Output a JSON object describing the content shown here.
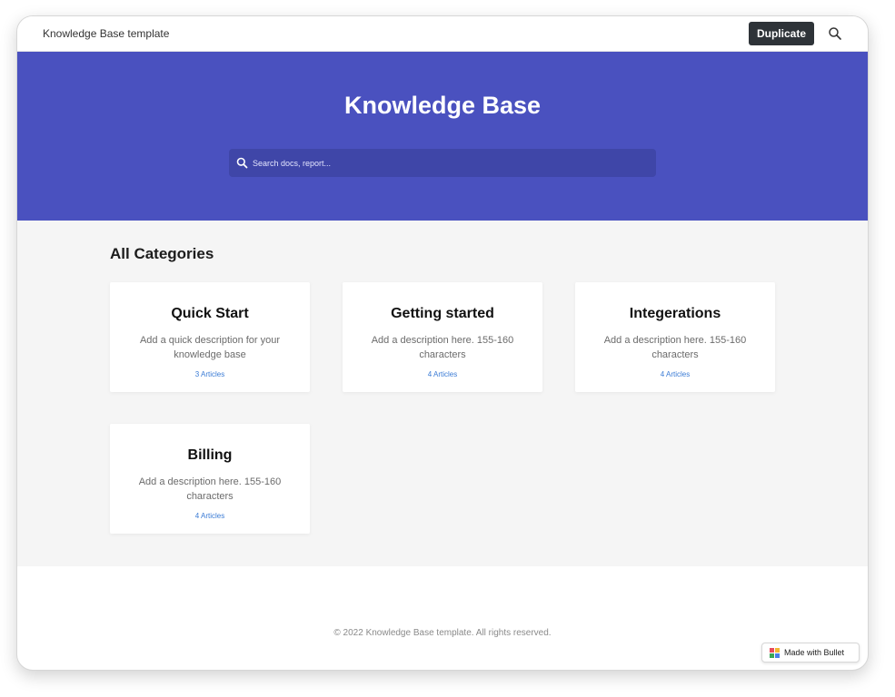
{
  "header": {
    "site_title": "Knowledge Base template",
    "duplicate_label": "Duplicate",
    "search_icon": "search-icon"
  },
  "hero": {
    "title": "Knowledge Base",
    "search_placeholder": "Search docs, report...",
    "background_color": "#4a51bf",
    "search_icon": "search-icon"
  },
  "main": {
    "section_title": "All Categories",
    "categories": [
      {
        "title": "Quick Start",
        "description": "Add a quick description for your knowledge base",
        "articles": "3 Articles"
      },
      {
        "title": "Getting started",
        "description": "Add a description here. 155-160 characters",
        "articles": "4 Articles"
      },
      {
        "title": "Integerations",
        "description": "Add a description here. 155-160 characters",
        "articles": "4 Articles"
      },
      {
        "title": "Billing",
        "description": "Add a description here. 155-160 characters",
        "articles": "4 Articles"
      }
    ]
  },
  "footer": {
    "copyright": "© 2022 Knowledge Base template. All rights reserved.",
    "badge_label": "Made with Bullet",
    "badge_icon": "bullet-logo-icon"
  },
  "colors": {
    "hero_bg": "#4a51bf",
    "button_bg": "#2e3338",
    "link": "#3a7bd5",
    "page_bg": "#f5f5f5"
  }
}
